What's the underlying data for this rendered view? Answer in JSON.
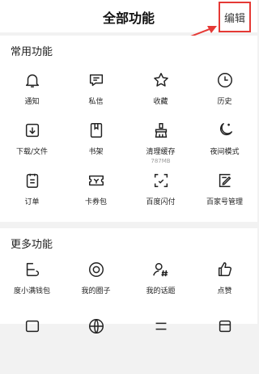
{
  "header": {
    "title": "全部功能",
    "edit_label": "编辑"
  },
  "common": {
    "title": "常用功能",
    "items": [
      {
        "label": "通知"
      },
      {
        "label": "私信"
      },
      {
        "label": "收藏"
      },
      {
        "label": "历史"
      },
      {
        "label": "下载/文件"
      },
      {
        "label": "书架"
      },
      {
        "label": "清理缓存",
        "sub": "787MB"
      },
      {
        "label": "夜间模式"
      },
      {
        "label": "订单"
      },
      {
        "label": "卡券包"
      },
      {
        "label": "百度闪付"
      },
      {
        "label": "百家号管理"
      }
    ]
  },
  "more": {
    "title": "更多功能",
    "items": [
      {
        "label": "度小满钱包"
      },
      {
        "label": "我的圈子"
      },
      {
        "label": "我的话题"
      },
      {
        "label": "点赞"
      }
    ]
  }
}
